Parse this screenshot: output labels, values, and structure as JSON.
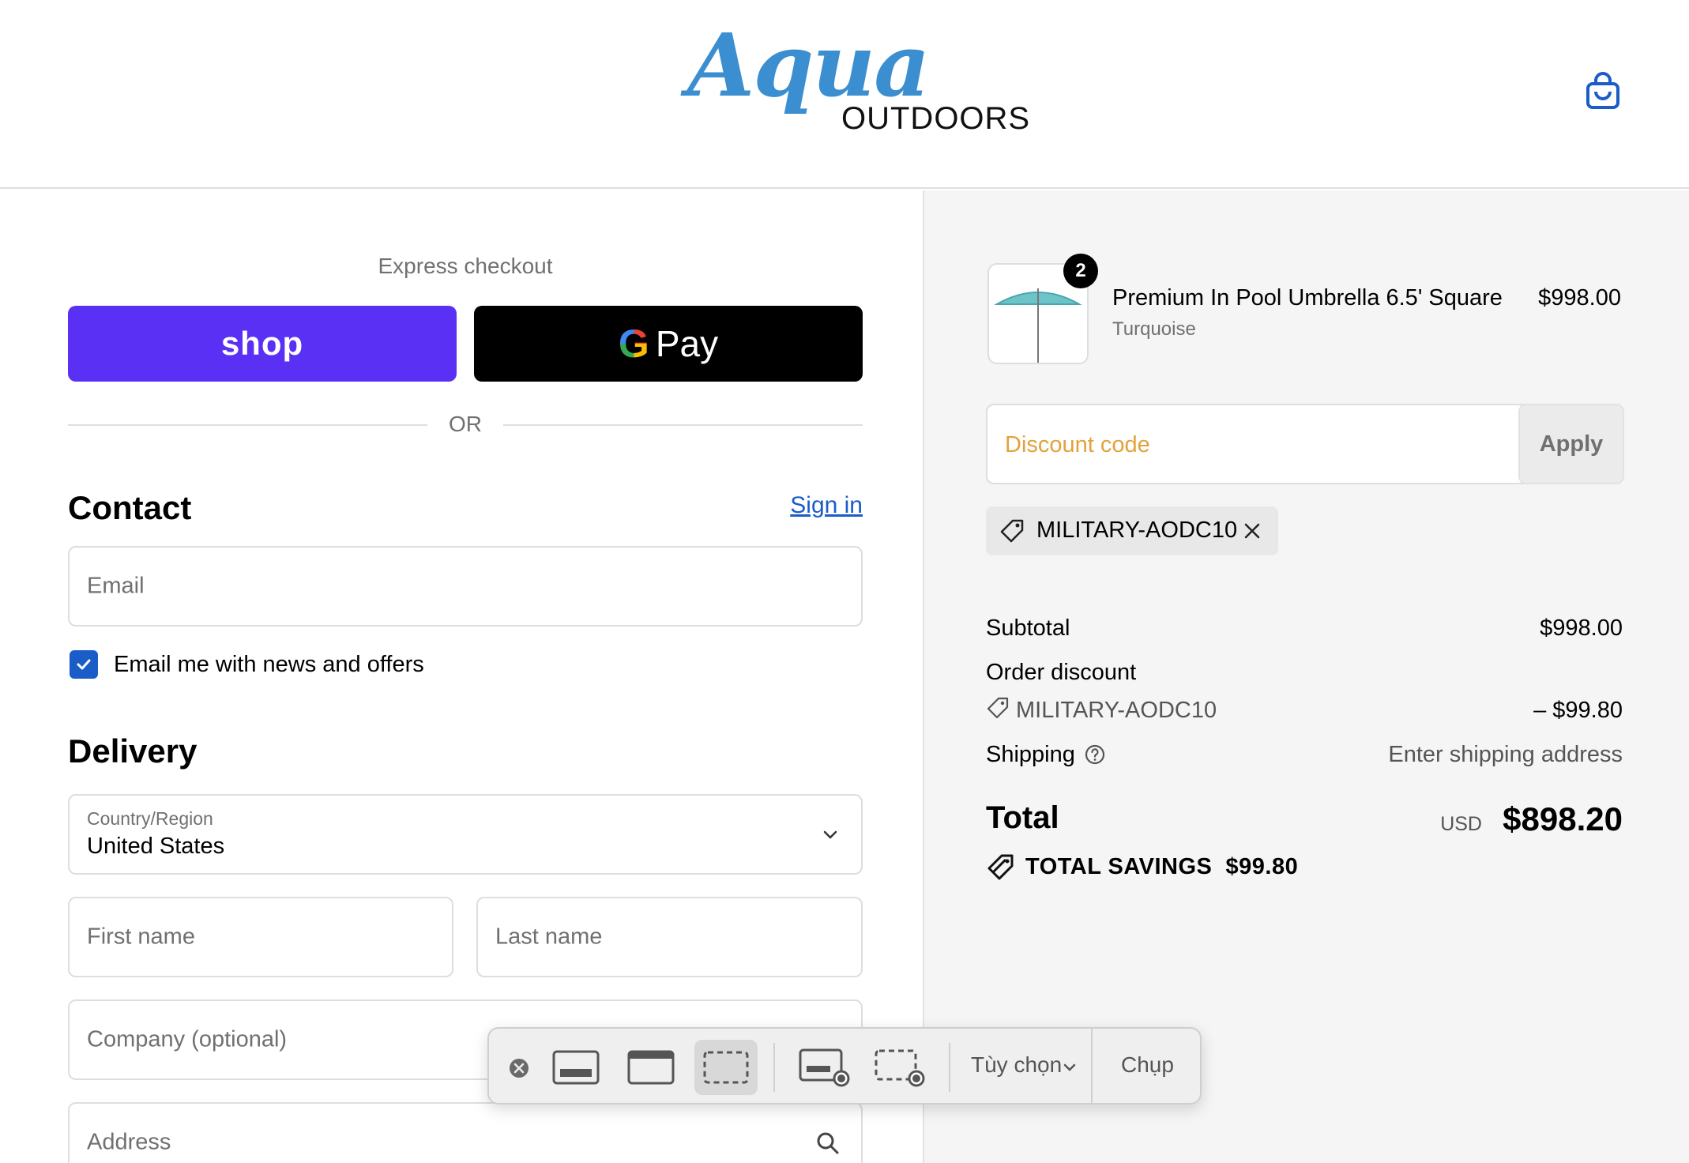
{
  "brand": {
    "logo_script": "Aqua",
    "logo_sub": "OUTDOORS"
  },
  "express": {
    "label": "Express checkout",
    "shop_label": "shop",
    "gpay_g": "G",
    "gpay_label": "Pay",
    "or_label": "OR"
  },
  "contact": {
    "title": "Contact",
    "signin_label": "Sign in",
    "email_placeholder": "Email",
    "newsletter_label": "Email me with news and offers",
    "newsletter_checked": true
  },
  "delivery": {
    "title": "Delivery",
    "country_label": "Country/Region",
    "country_value": "United States",
    "first_name_placeholder": "First name",
    "last_name_placeholder": "Last name",
    "company_placeholder": "Company (optional)",
    "address_placeholder": "Address"
  },
  "order": {
    "item": {
      "quantity": "2",
      "name": "Premium In Pool Umbrella 6.5' Square",
      "variant": "Turquoise",
      "price": "$998.00"
    },
    "discount_placeholder": "Discount code",
    "apply_label": "Apply",
    "applied_code": "MILITARY-AODC10",
    "subtotal_label": "Subtotal",
    "subtotal_value": "$998.00",
    "order_discount_label": "Order discount",
    "order_discount_code": "MILITARY-AODC10",
    "order_discount_value": "– $99.80",
    "shipping_label": "Shipping",
    "shipping_value": "Enter shipping address",
    "total_label": "Total",
    "total_currency": "USD",
    "total_value": "$898.20",
    "savings_label": "TOTAL SAVINGS",
    "savings_value": "$99.80"
  },
  "capture_toolbar": {
    "options_label": "Tùy chọn",
    "capture_label": "Chụp"
  },
  "colors": {
    "shop_purple": "#5a31f4",
    "link_blue": "#1a5dc9",
    "logo_blue": "#3b8fd0",
    "discount_placeholder": "#e2a23b"
  }
}
